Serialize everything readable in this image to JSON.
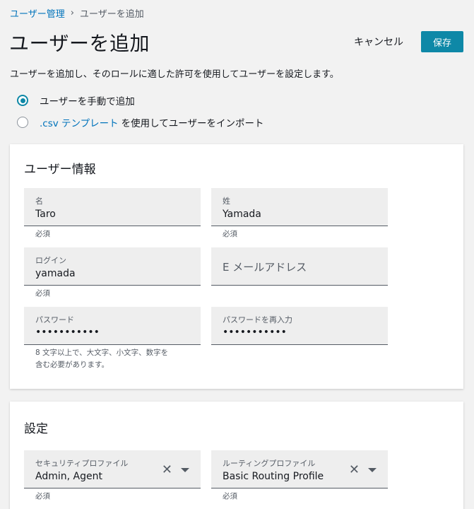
{
  "breadcrumb": {
    "parent": "ユーザー管理",
    "separator": "›",
    "current": "ユーザーを追加"
  },
  "header": {
    "title": "ユーザーを追加",
    "cancel_label": "キャンセル",
    "save_label": "保存"
  },
  "intro_text": "ユーザーを追加し、そのロールに適した許可を使用してユーザーを設定します。",
  "mode": {
    "manual_label": "ユーザーを手動で追加",
    "import_link": ".csv テンプレート",
    "import_suffix": "を使用してユーザーをインポート",
    "selected": "manual"
  },
  "user_info": {
    "title": "ユーザー情報",
    "first_name": {
      "label": "名",
      "value": "Taro",
      "hint": "必須"
    },
    "last_name": {
      "label": "姓",
      "value": "Yamada",
      "hint": "必須"
    },
    "login": {
      "label": "ログイン",
      "value": "yamada",
      "hint": "必須"
    },
    "email": {
      "placeholder": "E メールアドレス"
    },
    "password": {
      "label": "パスワード",
      "value": "•••••••••••",
      "hint_line1": "8 文字以上で、大文字、小文字、数字を",
      "hint_line2": "含む必要があります。"
    },
    "password_confirm": {
      "label": "パスワードを再入力",
      "value": "•••••••••••"
    }
  },
  "settings": {
    "title": "設定",
    "security_profile": {
      "label": "セキュリティプロファイル",
      "value": "Admin, Agent",
      "hint": "必須"
    },
    "routing_profile": {
      "label": "ルーティングプロファイル",
      "value": "Basic Routing Profile",
      "hint": "必須"
    }
  },
  "colors": {
    "accent": "#0e88a7",
    "link": "#0073bb",
    "background": "#f2f2f2"
  },
  "icons": {
    "clear": "close-icon",
    "dropdown": "caret-down-icon"
  }
}
